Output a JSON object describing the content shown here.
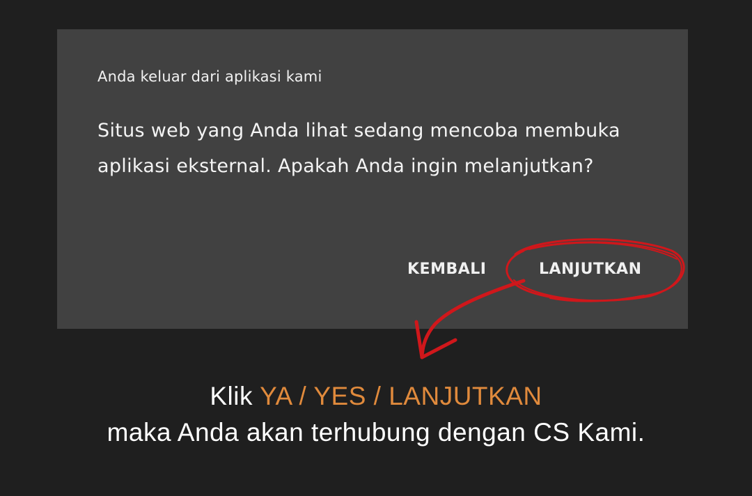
{
  "dialog": {
    "title": "Anda keluar dari aplikasi kami",
    "message": "Situs web yang Anda lihat sedang mencoba membuka aplikasi eksternal. Apakah Anda ingin melanjutkan?",
    "buttons": {
      "back_label": "KEMBALI",
      "continue_label": "LANJUTKAN"
    }
  },
  "caption": {
    "line1_prefix": "Klik ",
    "line1_highlight": "YA / YES / LANJUTKAN",
    "line2": "maka Anda akan terhubung dengan CS Kami."
  },
  "colors": {
    "background": "#1f1f1f",
    "dialog_bg": "#414141",
    "annotation_red": "#d0171b",
    "highlight_orange": "#e08a3c"
  },
  "annotations": {
    "circle": "hand-drawn-circle-around-continue",
    "arrow": "curved-arrow-pointing-down"
  }
}
